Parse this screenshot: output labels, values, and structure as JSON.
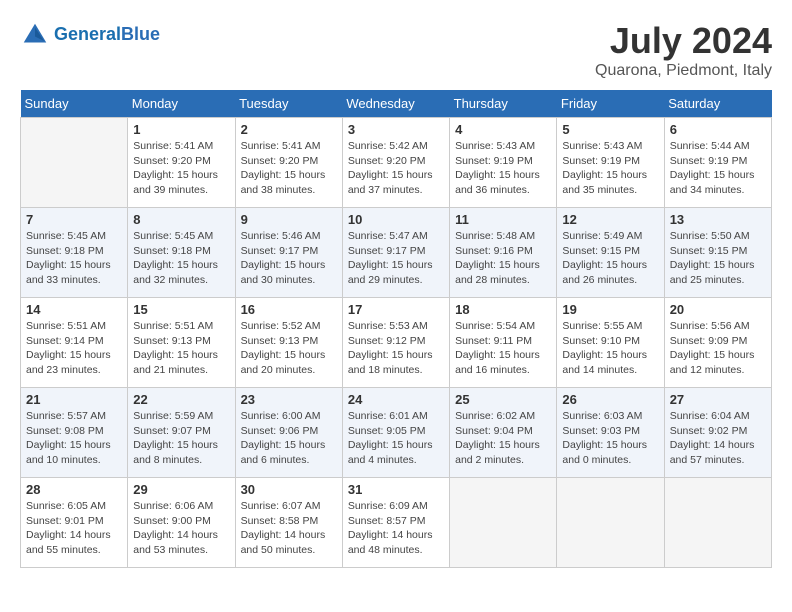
{
  "header": {
    "logo_line1": "General",
    "logo_line2": "Blue",
    "title": "July 2024",
    "subtitle": "Quarona, Piedmont, Italy"
  },
  "days_of_week": [
    "Sunday",
    "Monday",
    "Tuesday",
    "Wednesday",
    "Thursday",
    "Friday",
    "Saturday"
  ],
  "weeks": [
    [
      {
        "num": "",
        "empty": true
      },
      {
        "num": "1",
        "sunrise": "Sunrise: 5:41 AM",
        "sunset": "Sunset: 9:20 PM",
        "daylight": "Daylight: 15 hours and 39 minutes."
      },
      {
        "num": "2",
        "sunrise": "Sunrise: 5:41 AM",
        "sunset": "Sunset: 9:20 PM",
        "daylight": "Daylight: 15 hours and 38 minutes."
      },
      {
        "num": "3",
        "sunrise": "Sunrise: 5:42 AM",
        "sunset": "Sunset: 9:20 PM",
        "daylight": "Daylight: 15 hours and 37 minutes."
      },
      {
        "num": "4",
        "sunrise": "Sunrise: 5:43 AM",
        "sunset": "Sunset: 9:19 PM",
        "daylight": "Daylight: 15 hours and 36 minutes."
      },
      {
        "num": "5",
        "sunrise": "Sunrise: 5:43 AM",
        "sunset": "Sunset: 9:19 PM",
        "daylight": "Daylight: 15 hours and 35 minutes."
      },
      {
        "num": "6",
        "sunrise": "Sunrise: 5:44 AM",
        "sunset": "Sunset: 9:19 PM",
        "daylight": "Daylight: 15 hours and 34 minutes."
      }
    ],
    [
      {
        "num": "7",
        "sunrise": "Sunrise: 5:45 AM",
        "sunset": "Sunset: 9:18 PM",
        "daylight": "Daylight: 15 hours and 33 minutes."
      },
      {
        "num": "8",
        "sunrise": "Sunrise: 5:45 AM",
        "sunset": "Sunset: 9:18 PM",
        "daylight": "Daylight: 15 hours and 32 minutes."
      },
      {
        "num": "9",
        "sunrise": "Sunrise: 5:46 AM",
        "sunset": "Sunset: 9:17 PM",
        "daylight": "Daylight: 15 hours and 30 minutes."
      },
      {
        "num": "10",
        "sunrise": "Sunrise: 5:47 AM",
        "sunset": "Sunset: 9:17 PM",
        "daylight": "Daylight: 15 hours and 29 minutes."
      },
      {
        "num": "11",
        "sunrise": "Sunrise: 5:48 AM",
        "sunset": "Sunset: 9:16 PM",
        "daylight": "Daylight: 15 hours and 28 minutes."
      },
      {
        "num": "12",
        "sunrise": "Sunrise: 5:49 AM",
        "sunset": "Sunset: 9:15 PM",
        "daylight": "Daylight: 15 hours and 26 minutes."
      },
      {
        "num": "13",
        "sunrise": "Sunrise: 5:50 AM",
        "sunset": "Sunset: 9:15 PM",
        "daylight": "Daylight: 15 hours and 25 minutes."
      }
    ],
    [
      {
        "num": "14",
        "sunrise": "Sunrise: 5:51 AM",
        "sunset": "Sunset: 9:14 PM",
        "daylight": "Daylight: 15 hours and 23 minutes."
      },
      {
        "num": "15",
        "sunrise": "Sunrise: 5:51 AM",
        "sunset": "Sunset: 9:13 PM",
        "daylight": "Daylight: 15 hours and 21 minutes."
      },
      {
        "num": "16",
        "sunrise": "Sunrise: 5:52 AM",
        "sunset": "Sunset: 9:13 PM",
        "daylight": "Daylight: 15 hours and 20 minutes."
      },
      {
        "num": "17",
        "sunrise": "Sunrise: 5:53 AM",
        "sunset": "Sunset: 9:12 PM",
        "daylight": "Daylight: 15 hours and 18 minutes."
      },
      {
        "num": "18",
        "sunrise": "Sunrise: 5:54 AM",
        "sunset": "Sunset: 9:11 PM",
        "daylight": "Daylight: 15 hours and 16 minutes."
      },
      {
        "num": "19",
        "sunrise": "Sunrise: 5:55 AM",
        "sunset": "Sunset: 9:10 PM",
        "daylight": "Daylight: 15 hours and 14 minutes."
      },
      {
        "num": "20",
        "sunrise": "Sunrise: 5:56 AM",
        "sunset": "Sunset: 9:09 PM",
        "daylight": "Daylight: 15 hours and 12 minutes."
      }
    ],
    [
      {
        "num": "21",
        "sunrise": "Sunrise: 5:57 AM",
        "sunset": "Sunset: 9:08 PM",
        "daylight": "Daylight: 15 hours and 10 minutes."
      },
      {
        "num": "22",
        "sunrise": "Sunrise: 5:59 AM",
        "sunset": "Sunset: 9:07 PM",
        "daylight": "Daylight: 15 hours and 8 minutes."
      },
      {
        "num": "23",
        "sunrise": "Sunrise: 6:00 AM",
        "sunset": "Sunset: 9:06 PM",
        "daylight": "Daylight: 15 hours and 6 minutes."
      },
      {
        "num": "24",
        "sunrise": "Sunrise: 6:01 AM",
        "sunset": "Sunset: 9:05 PM",
        "daylight": "Daylight: 15 hours and 4 minutes."
      },
      {
        "num": "25",
        "sunrise": "Sunrise: 6:02 AM",
        "sunset": "Sunset: 9:04 PM",
        "daylight": "Daylight: 15 hours and 2 minutes."
      },
      {
        "num": "26",
        "sunrise": "Sunrise: 6:03 AM",
        "sunset": "Sunset: 9:03 PM",
        "daylight": "Daylight: 15 hours and 0 minutes."
      },
      {
        "num": "27",
        "sunrise": "Sunrise: 6:04 AM",
        "sunset": "Sunset: 9:02 PM",
        "daylight": "Daylight: 14 hours and 57 minutes."
      }
    ],
    [
      {
        "num": "28",
        "sunrise": "Sunrise: 6:05 AM",
        "sunset": "Sunset: 9:01 PM",
        "daylight": "Daylight: 14 hours and 55 minutes."
      },
      {
        "num": "29",
        "sunrise": "Sunrise: 6:06 AM",
        "sunset": "Sunset: 9:00 PM",
        "daylight": "Daylight: 14 hours and 53 minutes."
      },
      {
        "num": "30",
        "sunrise": "Sunrise: 6:07 AM",
        "sunset": "Sunset: 8:58 PM",
        "daylight": "Daylight: 14 hours and 50 minutes."
      },
      {
        "num": "31",
        "sunrise": "Sunrise: 6:09 AM",
        "sunset": "Sunset: 8:57 PM",
        "daylight": "Daylight: 14 hours and 48 minutes."
      },
      {
        "num": "",
        "empty": true
      },
      {
        "num": "",
        "empty": true
      },
      {
        "num": "",
        "empty": true
      }
    ]
  ]
}
